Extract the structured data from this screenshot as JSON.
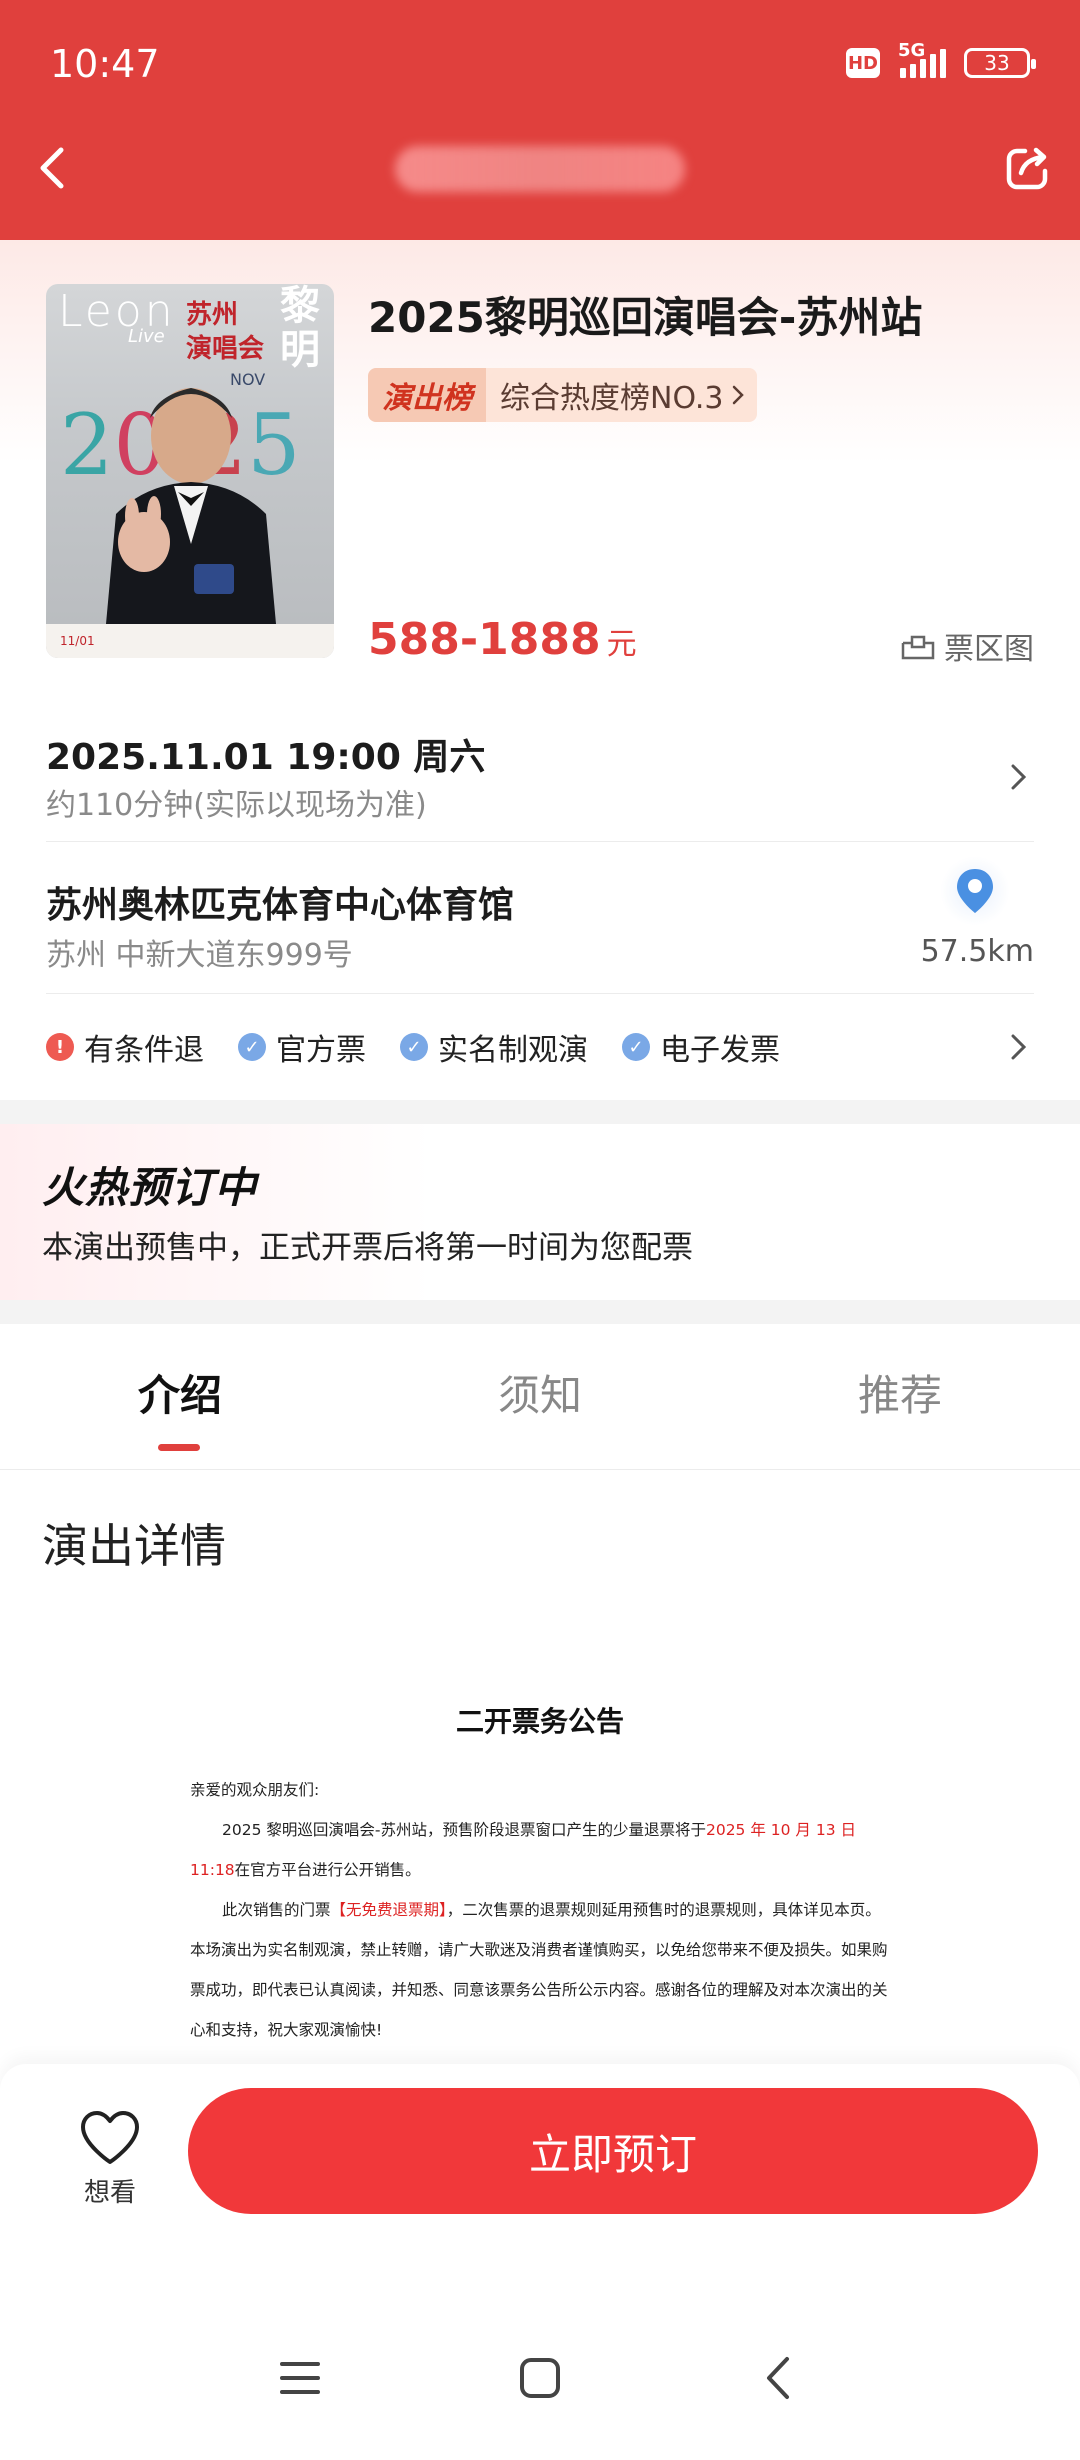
{
  "status_bar": {
    "time": "10:47",
    "hd": "HD",
    "network": "5G",
    "battery": "33"
  },
  "header": {
    "title_blurred": true
  },
  "show": {
    "title": "2025黎明巡回演唱会-苏州站",
    "rank_tag": "演出榜",
    "rank_value": "综合热度榜NO.3",
    "price": "588-1888",
    "price_unit": "元",
    "seat_map": "票区图",
    "poster": {
      "leon": "Leon",
      "live": "Live",
      "city": "苏州\n演唱会",
      "name": "黎\n明",
      "nov": "NOV",
      "year": "2025",
      "footer": "11/01"
    }
  },
  "schedule": {
    "datetime": "2025.11.01 19:00 周六",
    "duration": "约110分钟(实际以现场为准)"
  },
  "venue": {
    "name": "苏州奥林匹克体育中心体育馆",
    "address": "苏州 中新大道东999号",
    "distance": "57.5km"
  },
  "services": [
    {
      "label": "有条件退",
      "color": "#ee5a52",
      "mark": "!"
    },
    {
      "label": "官方票",
      "color": "#7aa8e6",
      "mark": "✓"
    },
    {
      "label": "实名制观演",
      "color": "#7aa8e6",
      "mark": "✓"
    },
    {
      "label": "电子发票",
      "color": "#7aa8e6",
      "mark": "✓"
    }
  ],
  "presale": {
    "title": "火热预订中",
    "desc": "本演出预售中，正式开票后将第一时间为您配票"
  },
  "tabs": [
    "介绍",
    "须知",
    "推荐"
  ],
  "detail": {
    "section_title": "演出详情"
  },
  "notice": {
    "title": "二开票务公告",
    "greeting": "亲爱的观众朋友们:",
    "p1_before": "2025 黎明巡回演唱会-苏州站，预售阶段退票窗口产生的少量退票将于",
    "p1_highlight": "2025 年 10 月 13 日 11:18",
    "p1_after": "在官方平台进行公开销售。",
    "p2_before": "此次销售的门票",
    "p2_highlight": "【无免费退票期】",
    "p2_after": "，二次售票的退票规则延用预售时的退票规则，具体详见本页。本场演出为实名制观演，禁止转赠，请广大歌迷及消费者谨慎购买，以免给您带来不便及损失。如果购票成功，即代表已认真阅读，并知悉、同意该票务公告所公示内容。感谢各位的理解及对本次演出的关心和支持，祝大家观演愉快!"
  },
  "bottom": {
    "wish": "想看",
    "book": "立即预订"
  },
  "colors": {
    "brand": "#e0403d",
    "button": "#f1383a"
  }
}
